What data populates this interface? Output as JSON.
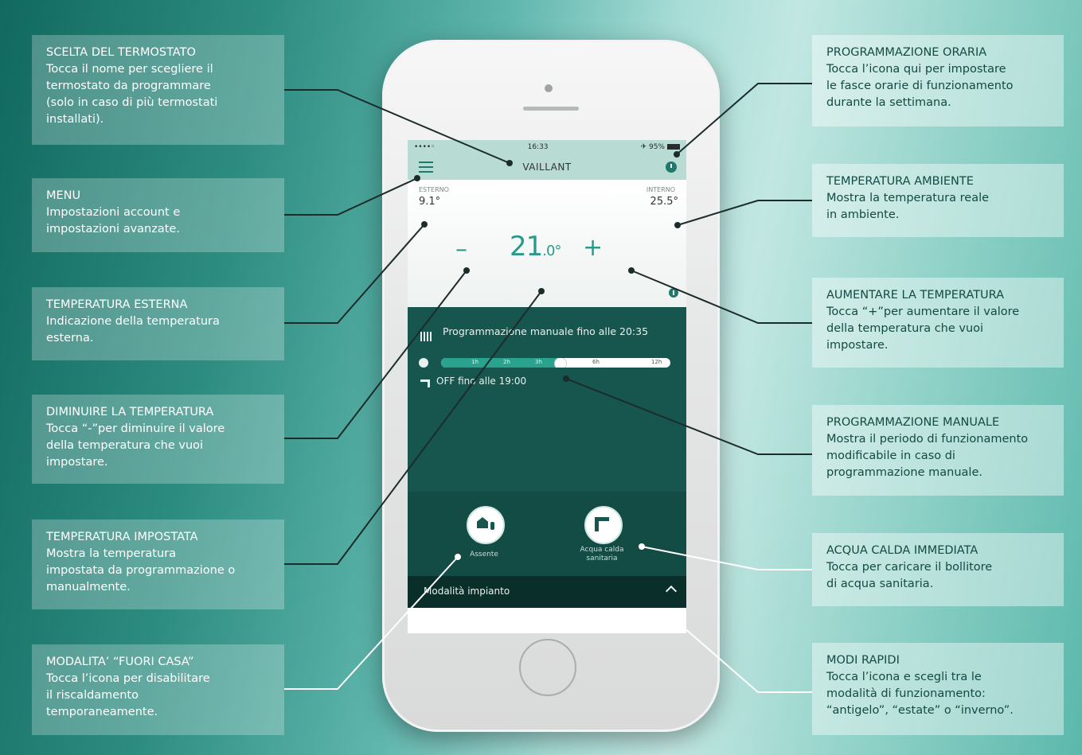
{
  "callouts_left": [
    {
      "title": "SCELTA DEL TERMOSTATO",
      "body": "Tocca il nome per scegliere il\ntermostato da programmare\n(solo in caso di più termostati\ninstallati)."
    },
    {
      "title": "MENU",
      "body": "Impostazioni account e\nimpostazioni avanzate."
    },
    {
      "title": "TEMPERATURA ESTERNA",
      "body": "Indicazione della temperatura\nesterna."
    },
    {
      "title": "DIMINUIRE LA TEMPERATURA",
      "body": "Tocca “-”per diminuire il valore\ndella temperatura che vuoi\nimpostare."
    },
    {
      "title": "TEMPERATURA IMPOSTATA",
      "body": "Mostra la temperatura\nimpostata da programmazione o\nmanualmente."
    },
    {
      "title": "MODALITA’ “FUORI CASA”",
      "body": "Tocca l’icona per disabilitare\nil riscaldamento\ntemporaneamente."
    }
  ],
  "callouts_right": [
    {
      "title": "PROGRAMMAZIONE ORARIA",
      "body": "Tocca l’icona qui per impostare\nle fasce orarie di funzionamento\ndurante la settimana."
    },
    {
      "title": "TEMPERATURA AMBIENTE",
      "body": "Mostra la temperatura reale\nin ambiente."
    },
    {
      "title": "AUMENTARE LA TEMPERATURA",
      "body": "Tocca “+”per aumentare il valore\ndella temperatura che vuoi\nimpostare."
    },
    {
      "title": "PROGRAMMAZIONE MANUALE",
      "body": "Mostra il periodo di funzionamento\nmodificabile in caso di\nprogrammazione manuale."
    },
    {
      "title": "ACQUA CALDA IMMEDIATA",
      "body": "Tocca per caricare il bollitore\ndi acqua sanitaria."
    },
    {
      "title": "MODI RAPIDI",
      "body": "Tocca l’icona e scegli tra le\nmodalità di funzionamento:\n“antigelo”, “estate” o “inverno”."
    }
  ],
  "phone": {
    "status": {
      "signal": "••••◦",
      "time": "16:33",
      "battery": "✈ 95%"
    },
    "app_title": "VAILLANT",
    "outdoor": {
      "label": "ESTERNO",
      "value": "9.1°"
    },
    "indoor": {
      "label": "INTERNO",
      "value": "25.5°"
    },
    "minus_symbol": "–",
    "setpoint_int": "21",
    "setpoint_dec": ".0",
    "setpoint_unit": "°",
    "plus_symbol": "+",
    "program_text": "Programmazione manuale fino alle 20:35",
    "timebar_labels": [
      "1h",
      "2h",
      "3h",
      "6h",
      "12h"
    ],
    "hot_water_text": "OFF fino alle 19:00",
    "away_label": "Assente",
    "hot_water_label": "Acqua calda\nsanitaria",
    "mode_label": "Modalità impianto"
  },
  "colors": {
    "accent": "#2a9a88",
    "dark_panel": "#16564e",
    "footer": "#0a2f2b"
  }
}
